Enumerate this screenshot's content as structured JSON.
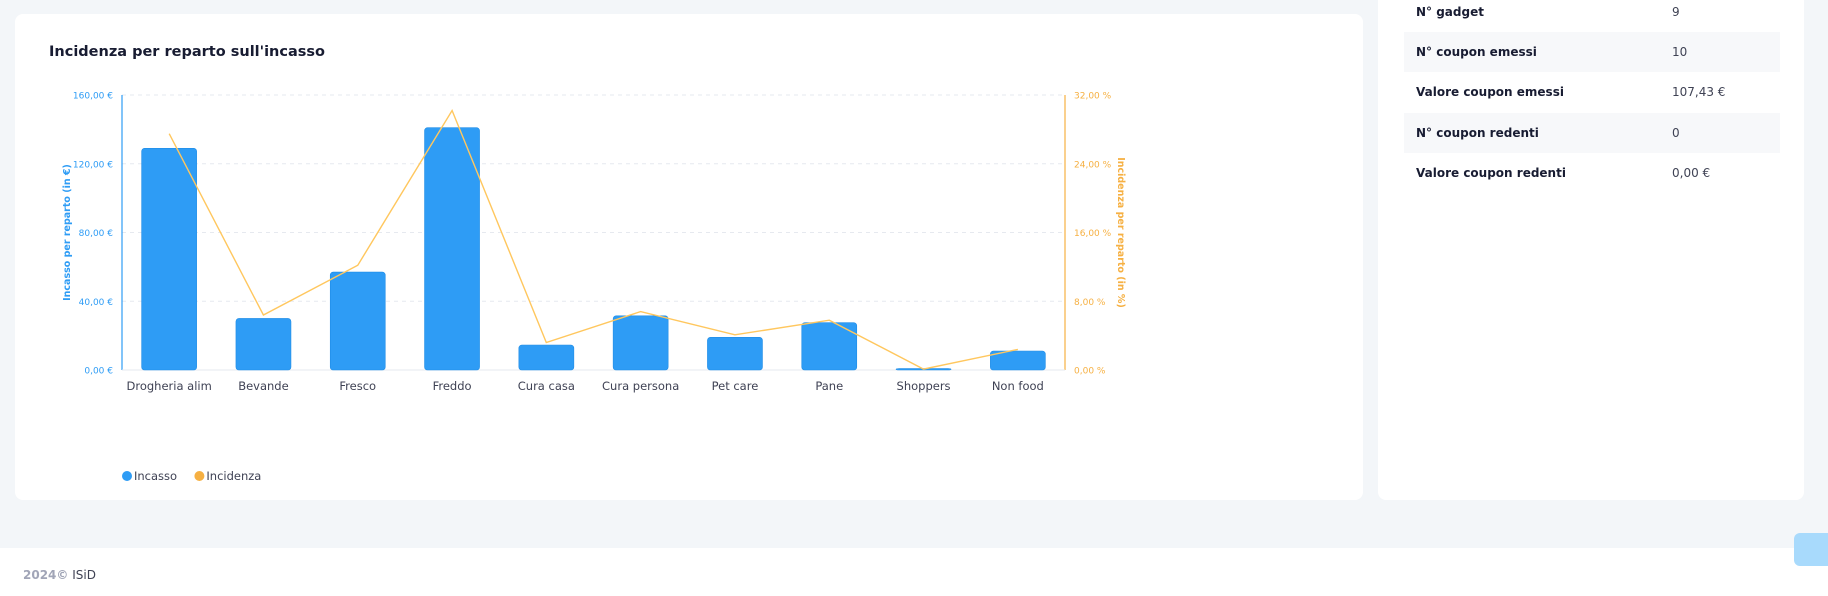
{
  "chart_card": {
    "title": "Incidenza per reparto sull'incasso"
  },
  "chart_data": {
    "type": "bar",
    "categories": [
      "Drogheria alim",
      "Bevande",
      "Fresco",
      "Freddo",
      "Cura casa",
      "Cura persona",
      "Pet care",
      "Pane",
      "Shoppers",
      "Non food"
    ],
    "series": [
      {
        "name": "Incasso",
        "type": "bar",
        "axis": "left",
        "color": "#2e9cf5",
        "values": [
          129,
          30,
          57,
          141,
          14.5,
          31.5,
          19,
          27.5,
          0.5,
          11
        ]
      },
      {
        "name": "Incidenza",
        "type": "line",
        "axis": "right",
        "color": "#ffc75e",
        "values": [
          27.5,
          6.4,
          12.2,
          30.2,
          3.2,
          6.8,
          4.1,
          5.8,
          0.1,
          2.4
        ]
      }
    ],
    "y_left": {
      "label": "Incasso per reparto (in €)",
      "ticks": [
        "0,00 €",
        "40,00 €",
        "80,00 €",
        "120,00 €",
        "160,00 €"
      ],
      "range": [
        0,
        160
      ],
      "color": "#2e9cf5"
    },
    "y_right": {
      "label": "Incidenza per reparto (in %)",
      "ticks": [
        "0,00 %",
        "8,00 %",
        "16,00 %",
        "24,00 %",
        "32,00 %"
      ],
      "range": [
        0,
        32
      ],
      "color": "#f6b042"
    },
    "legend": [
      "Incasso",
      "Incidenza"
    ],
    "legend_position": "bottom-left",
    "grid": true
  },
  "stats": [
    {
      "label": "N° gadget",
      "value": "9"
    },
    {
      "label": "N° coupon emessi",
      "value": "10"
    },
    {
      "label": "Valore coupon emessi",
      "value": "107,43 €"
    },
    {
      "label": "N° coupon redenti",
      "value": "0"
    },
    {
      "label": "Valore coupon redenti",
      "value": "0,00 €"
    }
  ],
  "footer": {
    "year": "2024©",
    "brand": "ISiD"
  }
}
